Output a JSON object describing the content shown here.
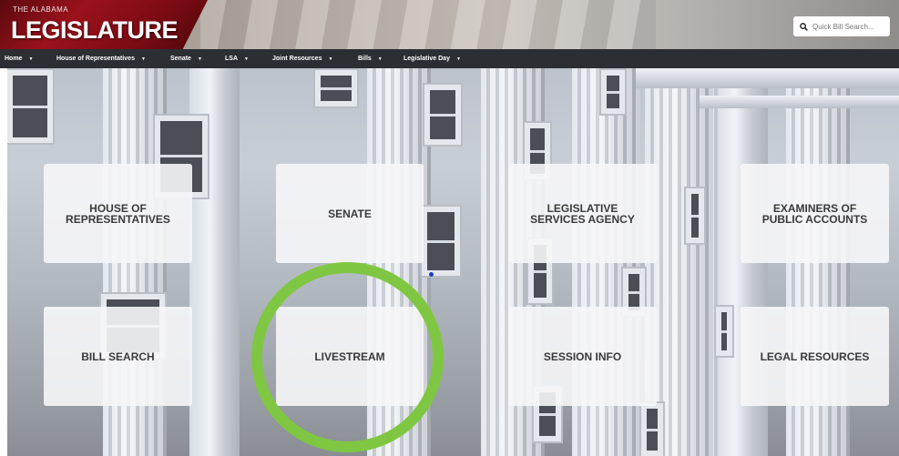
{
  "header": {
    "logo_top": "THE ALABAMA",
    "logo_main": "LEGISLATURE",
    "search_placeholder": "Quick Bill Search...",
    "search_icon": "search-icon"
  },
  "nav": {
    "items": [
      {
        "label": "Home"
      },
      {
        "label": "House of Representatives"
      },
      {
        "label": "Senate"
      },
      {
        "label": "LSA"
      },
      {
        "label": "Joint Resources"
      },
      {
        "label": "Bills"
      },
      {
        "label": "Legislative Day"
      }
    ],
    "arrow": "▼"
  },
  "tiles": [
    {
      "label": "HOUSE OF\nREPRESENTATIVES"
    },
    {
      "label": "SENATE"
    },
    {
      "label": "LEGISLATIVE\nSERVICES AGENCY"
    },
    {
      "label": "EXAMINERS OF\nPUBLIC ACCOUNTS"
    },
    {
      "label": "BILL SEARCH"
    },
    {
      "label": "LIVESTREAM"
    },
    {
      "label": "SESSION INFO"
    },
    {
      "label": "LEGAL RESOURCES"
    }
  ],
  "colors": {
    "logo_red": "#9b111c",
    "nav_bg": "#2b2f33",
    "highlight_ring": "#7fc742",
    "tile_bg": "#f6f6f8"
  }
}
